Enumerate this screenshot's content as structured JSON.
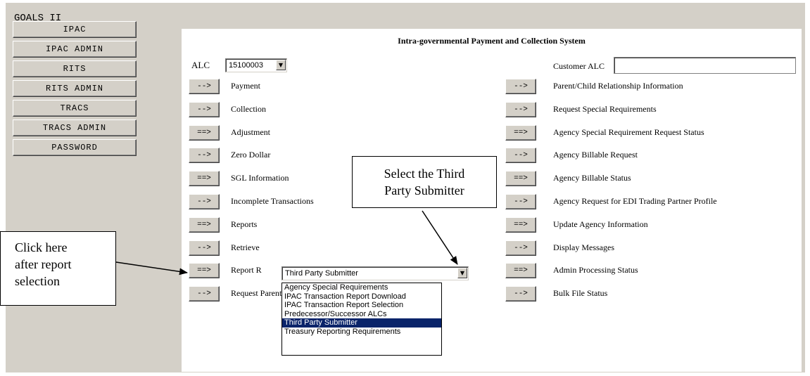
{
  "app_title": "GOALS II",
  "nav": [
    {
      "label": "IPAC"
    },
    {
      "label": "IPAC ADMIN"
    },
    {
      "label": "RITS"
    },
    {
      "label": "RITS ADMIN"
    },
    {
      "label": "TRACS"
    },
    {
      "label": "TRACS ADMIN"
    },
    {
      "label": "PASSWORD"
    }
  ],
  "panel_title": "Intra-governmental Payment and Collection System",
  "alc": {
    "label": "ALC",
    "selected": "15100003"
  },
  "customer_alc": {
    "label": "Customer ALC",
    "value": ""
  },
  "left_links": [
    {
      "button": "-->",
      "label": "Payment"
    },
    {
      "button": "-->",
      "label": "Collection"
    },
    {
      "button": "==>",
      "label": "Adjustment"
    },
    {
      "button": "-->",
      "label": "Zero Dollar"
    },
    {
      "button": "==>",
      "label": "SGL Information"
    },
    {
      "button": "-->",
      "label": "Incomplete Transactions"
    },
    {
      "button": "==>",
      "label": "Reports"
    },
    {
      "button": "-->",
      "label": "Retrieve"
    },
    {
      "button": "==>",
      "label": "Report R"
    },
    {
      "button": "-->",
      "label": "Request Parent/Child Relationship"
    }
  ],
  "right_links": [
    {
      "button": "-->",
      "label": "Parent/Child Relationship Information"
    },
    {
      "button": "-->",
      "label": "Request Special Requirements"
    },
    {
      "button": "==>",
      "label": "Agency Special Requirement Request Status"
    },
    {
      "button": "-->",
      "label": "Agency Billable Request"
    },
    {
      "button": "==>",
      "label": "Agency Billable Status"
    },
    {
      "button": "-->",
      "label": "Agency Request for EDI Trading Partner Profile"
    },
    {
      "button": "==>",
      "label": "Update Agency Information"
    },
    {
      "button": "-->",
      "label": "Display Messages"
    },
    {
      "button": "==>",
      "label": "Admin Processing Status"
    },
    {
      "button": "-->",
      "label": "Bulk File Status"
    }
  ],
  "reports_select": {
    "selected": "Third Party Submitter"
  },
  "reports_options": [
    "Agency Special Requirements",
    "IPAC Transaction Report Download",
    "IPAC Transaction Report Selection",
    "Predecessor/Successor ALCs",
    "Third Party Submitter",
    "Treasury Reporting Requirements"
  ],
  "callouts": {
    "select_third_party": [
      "Select the Third",
      "Party Submitter"
    ],
    "click_here": [
      "Click here",
      "after report",
      "selection"
    ]
  },
  "icons": {
    "dropdown": "chevron-down-icon"
  },
  "colors": {
    "window_bg": "#d4d0c8",
    "selection": "#0a246a"
  }
}
